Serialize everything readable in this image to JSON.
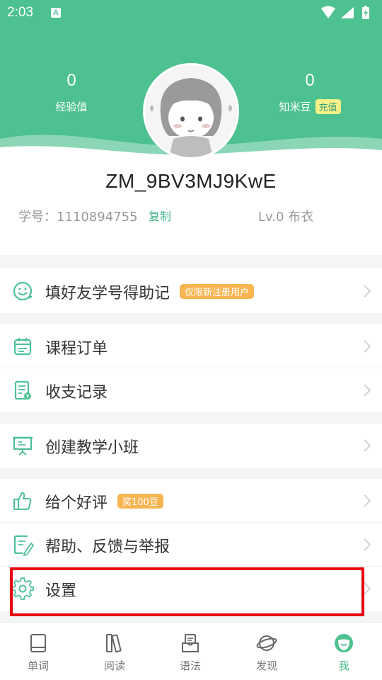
{
  "status_bar": {
    "time": "2:03",
    "notif_letter": "A"
  },
  "profile": {
    "exp_value": "0",
    "exp_label": "经验值",
    "beans_value": "0",
    "beans_label": "知米豆",
    "recharge_label": "充值",
    "username": "ZM_9BV3MJ9KwE",
    "student_id": "学号：1110894755",
    "copy_label": "复制",
    "level": "Lv.0 布衣"
  },
  "menu": {
    "invite": {
      "label": "填好友学号得助记",
      "badge": "仅限新注册用户"
    },
    "orders": {
      "label": "课程订单"
    },
    "records": {
      "label": "收支记录"
    },
    "class": {
      "label": "创建教学小班"
    },
    "review": {
      "label": "给个好评",
      "badge": "奖100豆"
    },
    "help": {
      "label": "帮助、反馈与举报"
    },
    "settings": {
      "label": "设置"
    }
  },
  "tabbar": {
    "tabs": [
      {
        "label": "单词",
        "icon": "book-icon"
      },
      {
        "label": "阅读",
        "icon": "books-icon"
      },
      {
        "label": "语法",
        "icon": "grammar-icon"
      },
      {
        "label": "发现",
        "icon": "planet-icon"
      },
      {
        "label": "我",
        "icon": "me-icon",
        "active": true
      }
    ]
  },
  "colors": {
    "brand": "#4dc190",
    "highlight": "#e8000f",
    "badge": "#f7b552"
  }
}
